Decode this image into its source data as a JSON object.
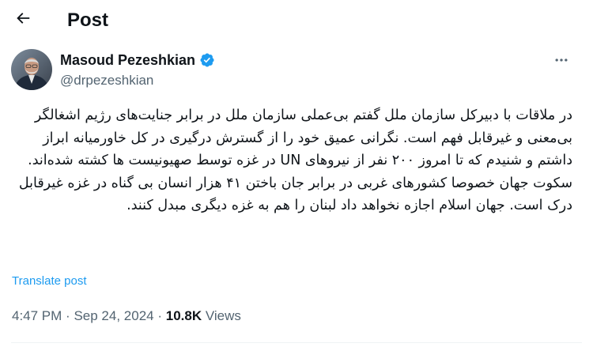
{
  "header": {
    "title": "Post",
    "back_icon": "arrow-left-icon"
  },
  "author": {
    "display_name": "Masoud Pezeshkian",
    "handle": "@drpezeshkian",
    "verified_icon": "verified-badge-icon",
    "verified_color": "#1d9bf0"
  },
  "tweet": {
    "paragraphs": [
      "در ملاقات با دبیرکل سازمان ملل گفتم بی‌عملی سازمان ملل در برابر جنایت‌های رژیم اشغالگر بی‌معنی و غیرقابل فهم است. نگرانی عمیق خود را از گسترش درگیری در کل خاورمیانه ابراز داشتم و شنیدم که تا امروز ۲۰۰ نفر از نیروهای UN در غزه توسط صهیونیست ها کشته شده‌اند.",
      "سکوت جهان خصوصا کشورهای غربی در برابر جان باختن ۴۱ هزار انسان بی گناه در غزه غیرقابل درک است. جهان اسلام اجازه نخواهد داد لبنان را هم به غزه دیگری مبدل کنند."
    ],
    "translate_label": "Translate post"
  },
  "meta": {
    "time": "4:47 PM",
    "separator": "·",
    "date": "Sep 24, 2024",
    "views_count": "10.8K",
    "views_label": "Views"
  },
  "colors": {
    "text_primary": "#0f1419",
    "text_secondary": "#536471",
    "accent": "#1d9bf0",
    "divider": "#eff3f4"
  }
}
